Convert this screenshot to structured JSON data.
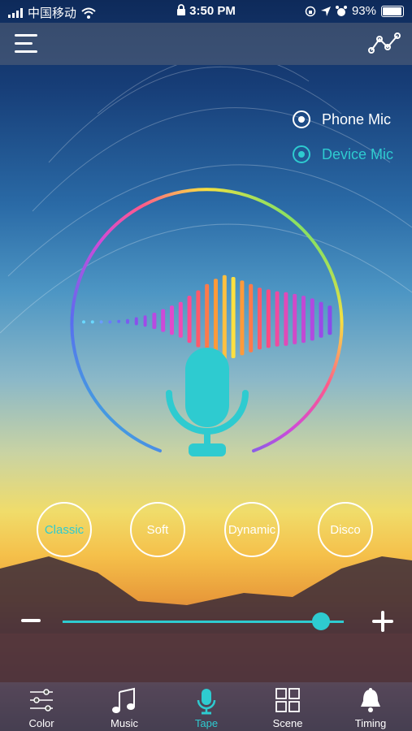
{
  "status_bar": {
    "carrier": "中国移动",
    "time": "3:50 PM",
    "battery": "93%"
  },
  "header": {
    "menu_icon": "hamburger-menu-icon",
    "graph_icon": "line-graph-icon"
  },
  "mic_source": {
    "options": [
      {
        "label": "Phone Mic",
        "selected": false
      },
      {
        "label": "Device Mic",
        "selected": true
      }
    ]
  },
  "modes": [
    {
      "label": "Classic",
      "active": true
    },
    {
      "label": "Soft",
      "active": false
    },
    {
      "label": "Dynamic",
      "active": false
    },
    {
      "label": "Disco",
      "active": false
    }
  ],
  "sensitivity": {
    "value": 0.92
  },
  "tabs": [
    {
      "label": "Color",
      "icon": "sliders-icon",
      "active": false
    },
    {
      "label": "Music",
      "icon": "music-note-icon",
      "active": false
    },
    {
      "label": "Tape",
      "icon": "microphone-icon",
      "active": true
    },
    {
      "label": "Scene",
      "icon": "grid-icon",
      "active": false
    },
    {
      "label": "Timing",
      "icon": "bell-icon",
      "active": false
    }
  ],
  "colors": {
    "accent": "#2ecbd0",
    "text": "#ffffff"
  }
}
